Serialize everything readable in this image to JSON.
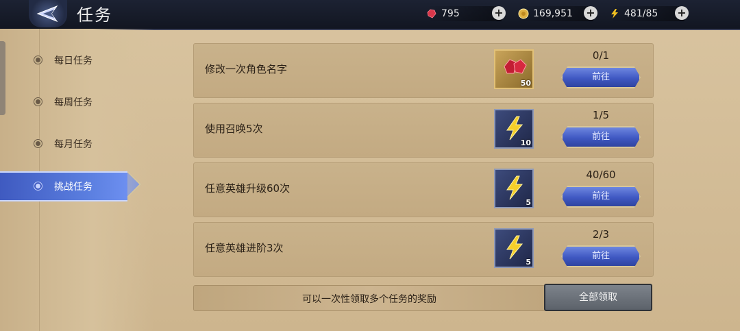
{
  "header": {
    "title": "任务",
    "resources": [
      {
        "name": "gem",
        "value": "795",
        "color": "#d9374a",
        "icon": "ruby-icon"
      },
      {
        "name": "gold",
        "value": "169,951",
        "color": "#e0b040",
        "icon": "coin-icon"
      },
      {
        "name": "energy",
        "value": "481/85",
        "color": "#f0c020",
        "icon": "lightning-icon"
      }
    ]
  },
  "sidebar": {
    "items": [
      {
        "label": "每日任务",
        "active": false
      },
      {
        "label": "每周任务",
        "active": false
      },
      {
        "label": "每月任务",
        "active": false
      },
      {
        "label": "挑战任务",
        "active": true
      }
    ]
  },
  "tasks": [
    {
      "name": "修改一次角色名字",
      "reward_icon": "ruby-icon",
      "reward_count": "50",
      "progress": "0/1",
      "button": "前往"
    },
    {
      "name": "使用召唤5次",
      "reward_icon": "lightning-icon",
      "reward_count": "10",
      "progress": "1/5",
      "button": "前往"
    },
    {
      "name": "任意英雄升级60次",
      "reward_icon": "lightning-icon",
      "reward_count": "5",
      "progress": "40/60",
      "button": "前往"
    },
    {
      "name": "任意英雄进阶3次",
      "reward_icon": "lightning-icon",
      "reward_count": "5",
      "progress": "2/3",
      "button": "前往"
    }
  ],
  "footer": {
    "hint": "可以一次性领取多个任务的奖励",
    "claim_all": "全部领取"
  }
}
